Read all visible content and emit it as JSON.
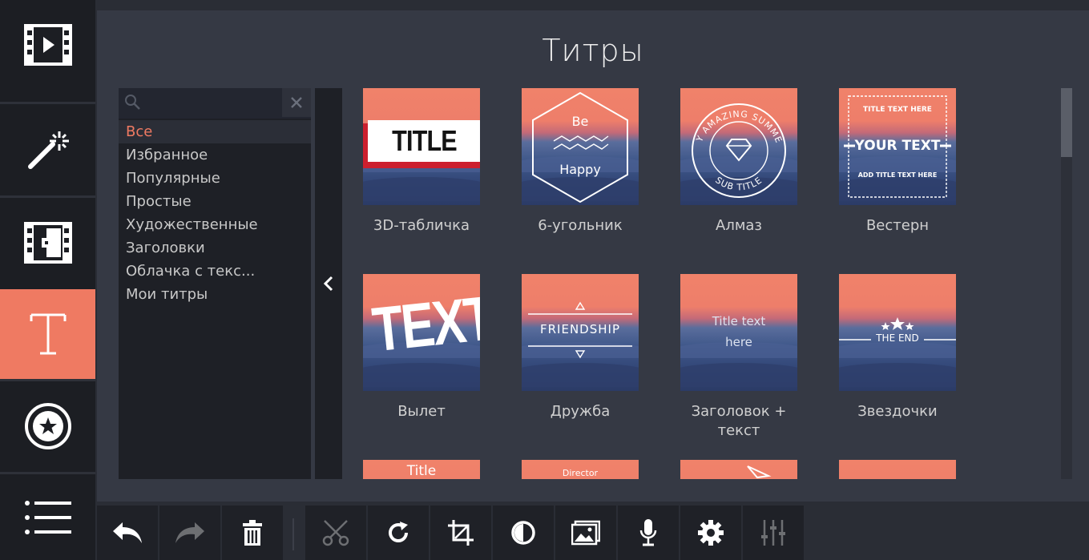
{
  "header": {
    "title": "Титры"
  },
  "search": {
    "placeholder": "",
    "value": ""
  },
  "categories": [
    {
      "label": "Все",
      "selected": true
    },
    {
      "label": "Избранное",
      "selected": false
    },
    {
      "label": "Популярные",
      "selected": false
    },
    {
      "label": "Простые",
      "selected": false
    },
    {
      "label": "Художественные",
      "selected": false
    },
    {
      "label": "Заголовки",
      "selected": false
    },
    {
      "label": "Облачка с текс...",
      "selected": false
    },
    {
      "label": "Мои титры",
      "selected": false
    }
  ],
  "tiles": [
    {
      "label": "3D-табличка",
      "thumb_text": "TITLE"
    },
    {
      "label": "6-угольник",
      "thumb_text": [
        "Be",
        "Happy"
      ]
    },
    {
      "label": "Алмаз",
      "thumb_text": [
        "MY AMAZING SUMMER",
        "SUB TITLE"
      ]
    },
    {
      "label": "Вестерн",
      "thumb_text": [
        "TITLE TEXT HERE",
        "YOUR TEXT",
        "ADD TITLE TEXT HERE"
      ]
    },
    {
      "label": "Вылет",
      "thumb_text": "TEXT"
    },
    {
      "label": "Дружба",
      "thumb_text": "FRIENDSHIP"
    },
    {
      "label": "Заголовок + текст",
      "thumb_text": [
        "Title text",
        "here"
      ]
    },
    {
      "label": "Звездочки",
      "thumb_text": "THE END"
    },
    {
      "label": "",
      "thumb_text": "Title"
    },
    {
      "label": "",
      "thumb_text": "Director"
    },
    {
      "label": "",
      "thumb_text": ""
    },
    {
      "label": "",
      "thumb_text": ""
    }
  ],
  "rail": [
    {
      "icon": "film-play-icon",
      "active": false
    },
    {
      "icon": "magic-wand-icon",
      "active": false
    },
    {
      "icon": "transition-icon",
      "active": false
    },
    {
      "icon": "title-t-icon",
      "active": true
    },
    {
      "icon": "sticker-star-icon",
      "active": false
    },
    {
      "icon": "menu-list-icon",
      "active": false
    }
  ],
  "toolbar": [
    {
      "icon": "undo-icon",
      "enabled": true
    },
    {
      "icon": "redo-icon",
      "enabled": false
    },
    {
      "icon": "trash-icon",
      "enabled": true
    },
    {
      "icon": "scissors-icon",
      "enabled": false
    },
    {
      "icon": "rotate-icon",
      "enabled": true
    },
    {
      "icon": "crop-icon",
      "enabled": true
    },
    {
      "icon": "color-adjust-icon",
      "enabled": true
    },
    {
      "icon": "image-icon",
      "enabled": true
    },
    {
      "icon": "microphone-icon",
      "enabled": true
    },
    {
      "icon": "gear-icon",
      "enabled": true
    },
    {
      "icon": "equalizer-icon",
      "enabled": false
    }
  ],
  "colors": {
    "accent": "#ef7a62",
    "rail_bg": "#1c1e23",
    "panel_bg": "#353944"
  }
}
